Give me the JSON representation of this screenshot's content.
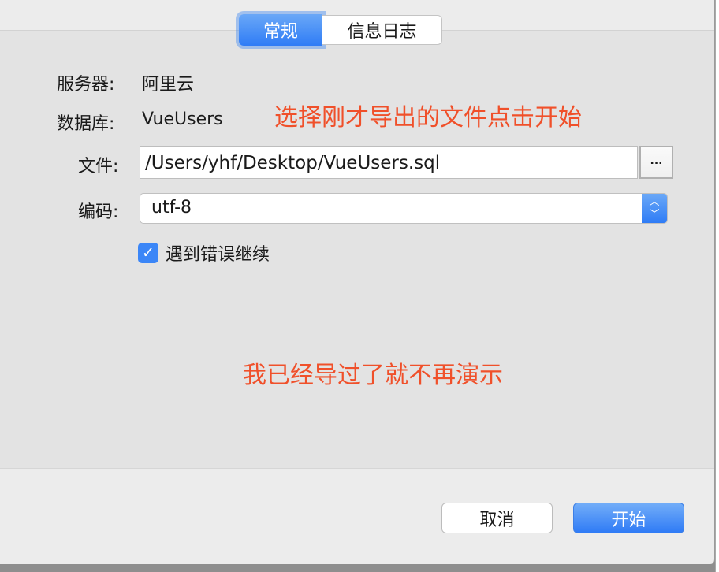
{
  "tabs": [
    {
      "label": "常规",
      "active": true
    },
    {
      "label": "信息日志",
      "active": false
    }
  ],
  "form": {
    "server_label": "服务器:",
    "server_value": "阿里云",
    "database_label": "数据库:",
    "database_value": "VueUsers",
    "file_label": "文件:",
    "file_value": "/Users/yhf/Desktop/VueUsers.sql",
    "browse_label": "...",
    "encoding_label": "编码:",
    "encoding_value": "utf-8",
    "continue_on_error_label": "遇到错误继续",
    "continue_on_error_checked": true
  },
  "annotations": {
    "top": "选择刚才导出的文件点击开始",
    "middle": "我已经导过了就不再演示"
  },
  "buttons": {
    "cancel": "取消",
    "start": "开始"
  },
  "colors": {
    "accent": "#2f7cf6",
    "annotation": "#f0502a"
  }
}
